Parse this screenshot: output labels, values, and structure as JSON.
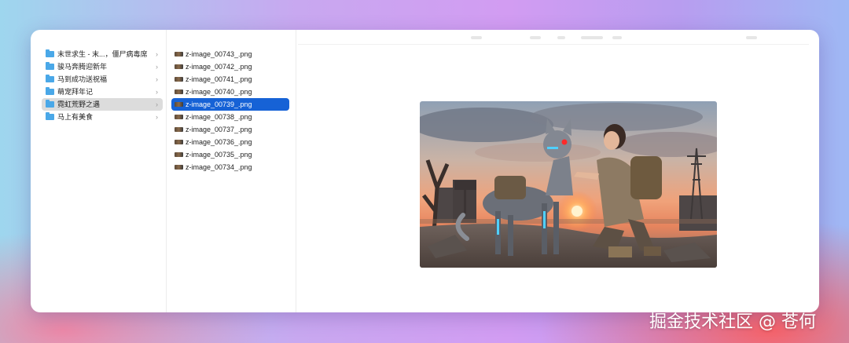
{
  "sidebar": {
    "folders": [
      {
        "label": "末世求生 - 末...，僵尸病毒席"
      },
      {
        "label": "骏马奔腾迎新年"
      },
      {
        "label": "马到成功送祝福"
      },
      {
        "label": "萌宠拜年记"
      },
      {
        "label": "霓虹荒野之遇"
      },
      {
        "label": "马上有美食"
      }
    ],
    "selected_index": 4
  },
  "files": {
    "items": [
      {
        "label": "z-image_00743_.png"
      },
      {
        "label": "z-image_00742_.png"
      },
      {
        "label": "z-image_00741_.png"
      },
      {
        "label": "z-image_00740_.png"
      },
      {
        "label": "z-image_00739_.png"
      },
      {
        "label": "z-image_00738_.png"
      },
      {
        "label": "z-image_00737_.png"
      },
      {
        "label": "z-image_00736_.png"
      },
      {
        "label": "z-image_00735_.png"
      },
      {
        "label": "z-image_00734_.png"
      }
    ],
    "selected_index": 4
  },
  "chevron_glyph": "›",
  "watermark": "掘金技术社区 @ 苍何",
  "colors": {
    "selection_blue": "#1662d6",
    "selection_gray": "#dcdcdc",
    "folder_blue": "#4aa8e8"
  }
}
